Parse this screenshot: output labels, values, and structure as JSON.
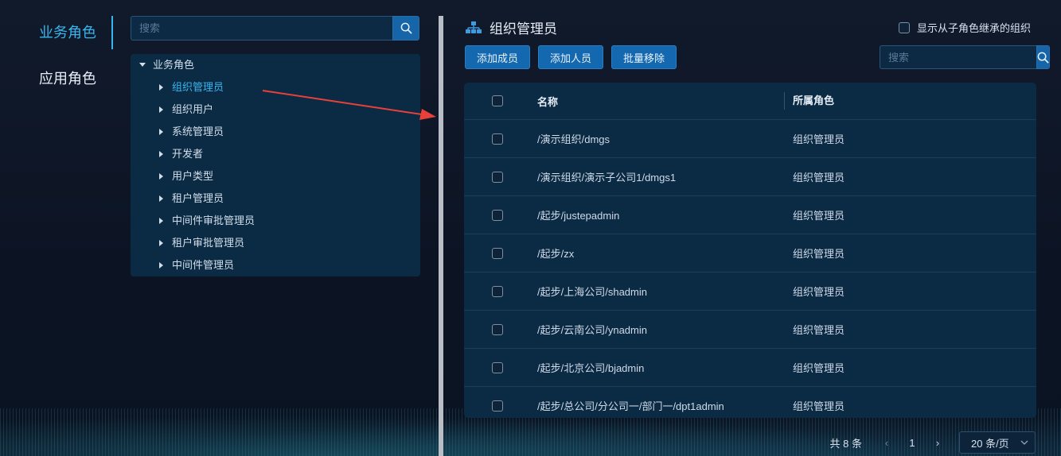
{
  "role_tabs": [
    {
      "label": "业务角色",
      "active": true
    },
    {
      "label": "应用角色",
      "active": false
    }
  ],
  "tree_search": {
    "placeholder": "搜索"
  },
  "tree": {
    "root": "业务角色",
    "children": [
      "组织管理员",
      "组织用户",
      "系统管理员",
      "开发者",
      "用户类型",
      "租户管理员",
      "中间件审批管理员",
      "租户审批管理员",
      "中间件管理员"
    ],
    "selected": "组织管理员"
  },
  "panel": {
    "title": "组织管理员",
    "inherit_label": "显示从子角色继承的组织"
  },
  "toolbar": {
    "add_member": "添加成员",
    "add_person": "添加人员",
    "batch_remove": "批量移除"
  },
  "list_search": {
    "placeholder": "搜索"
  },
  "table": {
    "columns": [
      "名称",
      "所属角色"
    ],
    "rows": [
      [
        "/演示组织/dmgs",
        "组织管理员"
      ],
      [
        "/演示组织/演示子公司1/dmgs1",
        "组织管理员"
      ],
      [
        "/起步/justepadmin",
        "组织管理员"
      ],
      [
        "/起步/zx",
        "组织管理员"
      ],
      [
        "/起步/上海公司/shadmin",
        "组织管理员"
      ],
      [
        "/起步/云南公司/ynadmin",
        "组织管理员"
      ],
      [
        "/起步/北京公司/bjadmin",
        "组织管理员"
      ],
      [
        "/起步/总公司/分公司一/部门一/dpt1admin",
        "组织管理员"
      ]
    ]
  },
  "pagination": {
    "total": "共 8 条",
    "current_page": "1",
    "page_size": "20 条/页"
  },
  "colors": {
    "accent": "#35b6f0",
    "button": "#1468b0",
    "panel_bg": "#0b2a44",
    "annotation_arrow": "#e8413a"
  },
  "icons": {
    "search": "search-icon",
    "org": "org-structure-icon",
    "caret": "caret-right-icon",
    "caret_down": "caret-down-icon"
  }
}
